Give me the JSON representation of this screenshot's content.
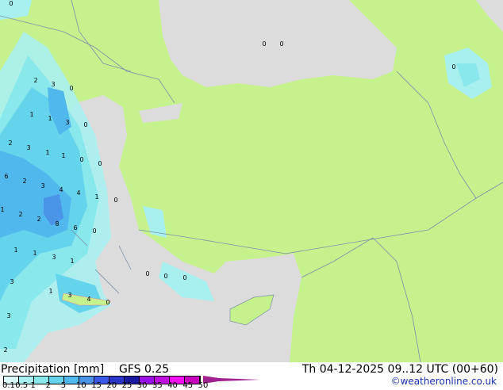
{
  "title": "Precipitation [mm]",
  "model": "GFS 0.25",
  "valid_time": "Th 04-12-2025 09..12 UTC (00+60)",
  "credit": "©weatheronline.co.uk",
  "colors": {
    "land": "#c6f28e",
    "sea": "#dcdcdc",
    "border": "#7a8fa8"
  },
  "colorbar": {
    "ticks": [
      "0.1",
      "0.5",
      "1",
      "2",
      "5",
      "10",
      "15",
      "20",
      "25",
      "30",
      "35",
      "40",
      "45",
      "50"
    ],
    "colors": [
      "#d8fafa",
      "#a8f0f0",
      "#88e8ec",
      "#64d4ec",
      "#50b8ec",
      "#4a94e8",
      "#3a5ae8",
      "#2a38c8",
      "#1a1aa0",
      "#9a10e8",
      "#c010e0",
      "#f010f0",
      "#c800c0",
      "#a02090"
    ]
  },
  "map_labels": [
    "0",
    "0",
    "0",
    "0",
    "2",
    "3",
    "0",
    "1",
    "1",
    "3",
    "0",
    "2",
    "3",
    "1",
    "1",
    "0",
    "0",
    "6",
    "2",
    "3",
    "4",
    "4",
    "1",
    "0",
    "1",
    "2",
    "2",
    "8",
    "6",
    "0",
    "1",
    "1",
    "3",
    "1",
    "0",
    "0",
    "0",
    "3",
    "1",
    "3",
    "4",
    "0",
    "3",
    "2"
  ]
}
